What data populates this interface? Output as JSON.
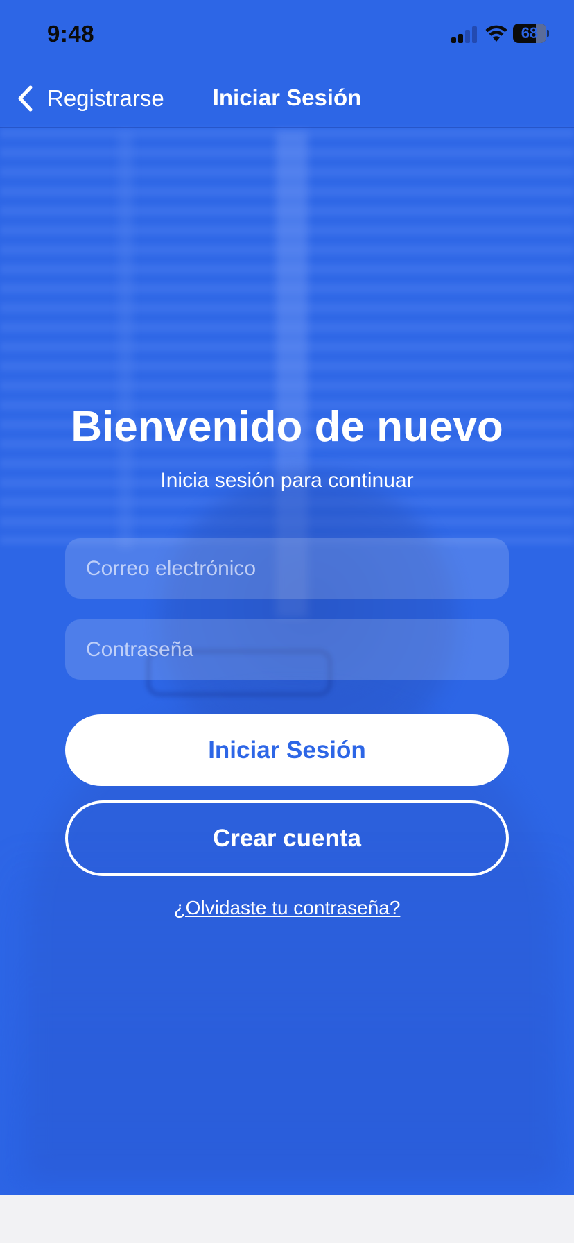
{
  "status_bar": {
    "time": "9:48",
    "battery_percent": "68",
    "battery_level": 0.68,
    "icons": [
      "signal-icon",
      "wifi-icon",
      "battery-icon"
    ]
  },
  "nav": {
    "back_label": "Registrarse",
    "title": "Iniciar Sesión",
    "back_icon": "chevron-left-icon"
  },
  "main": {
    "heading": "Bienvenido de nuevo",
    "subheading": "Inicia sesión para continuar",
    "email_placeholder": "Correo electrónico",
    "email_value": "",
    "password_placeholder": "Contraseña",
    "password_value": "",
    "login_button_label": "Iniciar Sesión",
    "signup_button_label": "Crear cuenta",
    "forgot_link": "¿Olvidaste tu contraseña?"
  },
  "colors": {
    "primary": "#2d66e6",
    "text_on_primary": "#ffffff",
    "bottom_area": "#f2f2f4"
  }
}
